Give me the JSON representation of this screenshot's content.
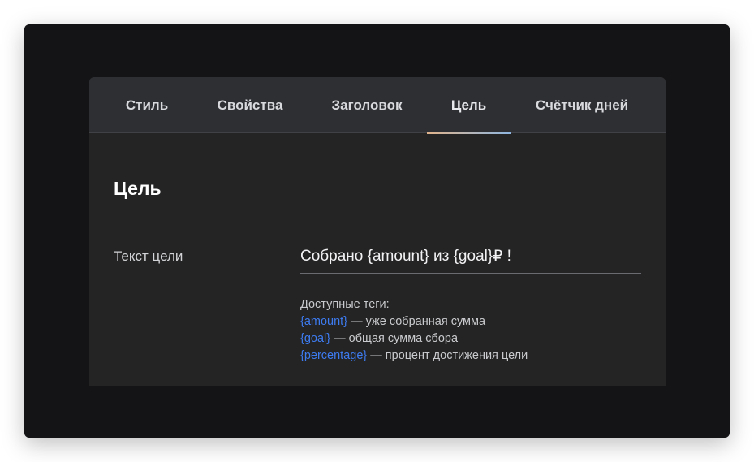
{
  "tabs": [
    {
      "label": "Стиль",
      "active": false
    },
    {
      "label": "Свойства",
      "active": false
    },
    {
      "label": "Заголовок",
      "active": false
    },
    {
      "label": "Цель",
      "active": true
    },
    {
      "label": "Счётчик дней",
      "active": false
    }
  ],
  "section": {
    "title": "Цель"
  },
  "goal_field": {
    "label": "Текст цели",
    "value": "Собрано {amount} из {goal}₽ !"
  },
  "tags": {
    "heading": "Доступные теги:",
    "items": [
      {
        "code": "{amount}",
        "description": " — уже собранная сумма"
      },
      {
        "code": "{goal}",
        "description": " — общая сумма сбора"
      },
      {
        "code": "{percentage}",
        "description": " — процент достижения цели"
      }
    ]
  },
  "colors": {
    "frame_background": "#141416",
    "panel_background": "#242424",
    "tabbar_background": "#2e2f33",
    "tag_link": "#3d7bf0",
    "indicator_start": "#e0b48c",
    "indicator_end": "#8fb6df"
  }
}
